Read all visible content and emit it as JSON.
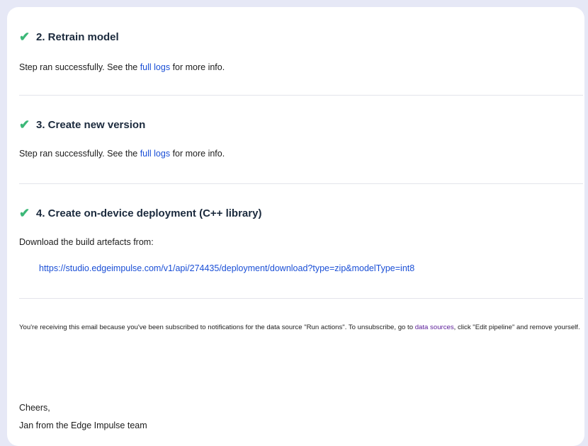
{
  "steps": [
    {
      "title": "2. Retrain model",
      "text_before": "Step ran successfully. See the ",
      "link": "full logs",
      "text_after": " for more info."
    },
    {
      "title": "3. Create new version",
      "text_before": "Step ran successfully. See the ",
      "link": "full logs",
      "text_after": " for more info."
    },
    {
      "title": "4. Create on-device deployment (C++ library)",
      "text": "Download the build artefacts from:",
      "url": "https://studio.edgeimpulse.com/v1/api/274435/deployment/download?type=zip&modelType=int8"
    }
  ],
  "check_glyph": "✔",
  "footer": {
    "notice_before": "You're receiving this email because you've been subscribed to notifications for the data source \"Run actions\". To unsubscribe, go to ",
    "notice_link": "data sources",
    "notice_after": ", click \"Edit pipeline\" and remove yourself.",
    "closing": "Cheers,",
    "signature": "Jan from the Edge Impulse team"
  },
  "colors": {
    "check": "#3cb878",
    "link": "#1a4fd6",
    "visited_link": "#5b1d99",
    "heading": "#1b2a3d",
    "background": "#e6e8f6"
  }
}
